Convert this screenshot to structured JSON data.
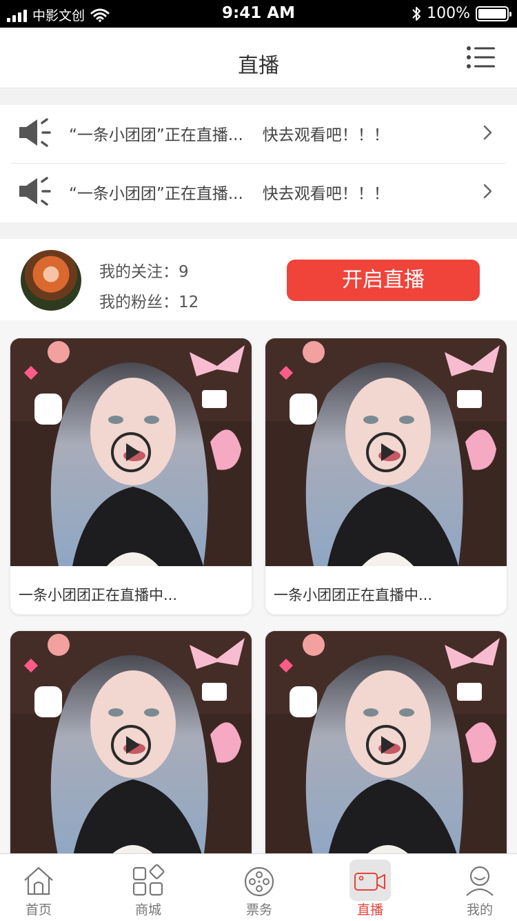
{
  "status_bar": {
    "carrier": "中影文创",
    "time": "9:41 AM",
    "battery": "100%"
  },
  "header": {
    "title": "直播"
  },
  "notices": [
    {
      "text": "“一条小团团”正在直播...",
      "cta": "快去观看吧！！！"
    },
    {
      "text": "“一条小团团”正在直播...",
      "cta": "快去观看吧！！！"
    }
  ],
  "profile": {
    "following": "我的关注：9",
    "fans": "我的粉丝：12",
    "start_live_label": "开启直播"
  },
  "streams": [
    {
      "caption": "一条小团团正在直播中..."
    },
    {
      "caption": "一条小团团正在直播中..."
    },
    {
      "caption": ""
    },
    {
      "caption": ""
    }
  ],
  "tabs": [
    {
      "label": "首页",
      "icon": "home-icon"
    },
    {
      "label": "商城",
      "icon": "shop-icon"
    },
    {
      "label": "票务",
      "icon": "film-reel-icon"
    },
    {
      "label": "直播",
      "icon": "video-camera-icon",
      "active": true
    },
    {
      "label": "我的",
      "icon": "user-icon"
    }
  ],
  "colors": {
    "accent": "#f0433a",
    "tab_active": "#e8433b"
  }
}
